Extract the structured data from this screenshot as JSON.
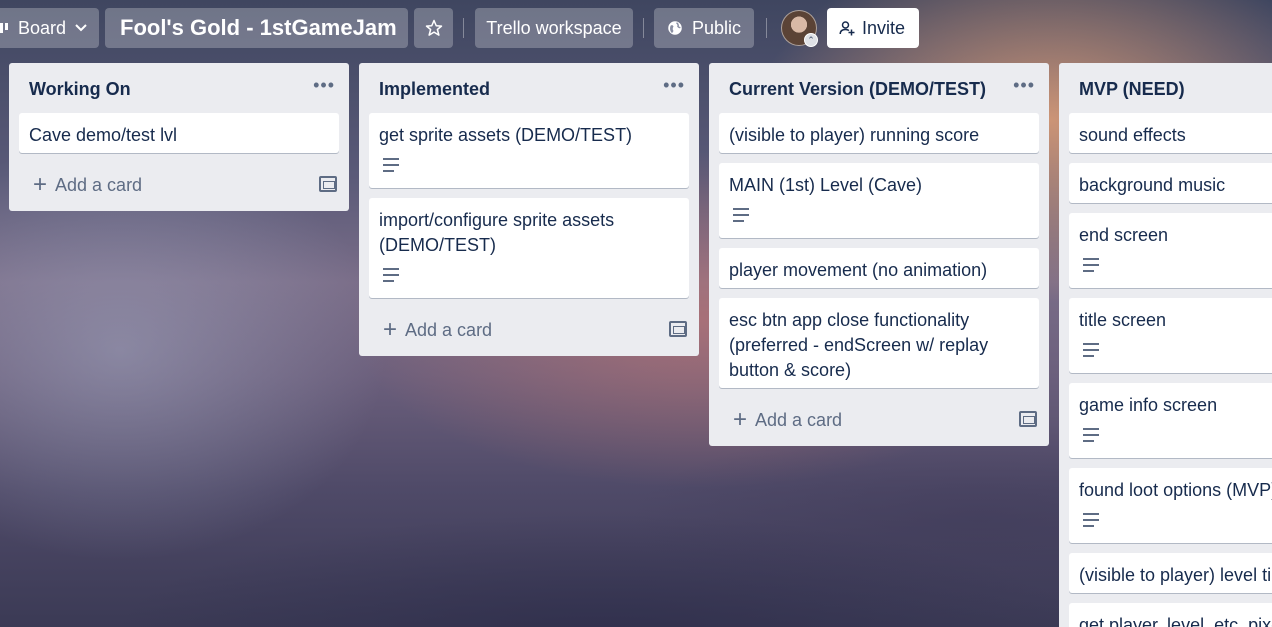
{
  "header": {
    "view_label": "Board",
    "board_title": "Fool's Gold - 1stGameJam",
    "workspace_label": "Trello workspace",
    "visibility_label": "Public",
    "invite_label": "Invite"
  },
  "lists": [
    {
      "title": "Working On",
      "cards": [
        {
          "title": "Cave demo/test lvl"
        }
      ],
      "add_label": "Add a card"
    },
    {
      "title": "Implemented",
      "cards": [
        {
          "title": "get sprite assets (DEMO/TEST)"
        },
        {
          "title": "import/configure sprite assets (DEMO/TEST)"
        }
      ],
      "add_label": "Add a card"
    },
    {
      "title": "Current Version (DEMO/TEST)",
      "cards": [
        {
          "title": "(visible to player) running score"
        },
        {
          "title": "MAIN (1st) Level (Cave)"
        },
        {
          "title": "player movement (no animation)"
        },
        {
          "title": "esc btn app close functionality (preferred - endScreen w/ replay button & score)"
        }
      ],
      "add_label": "Add a card"
    },
    {
      "title": "MVP (NEED)",
      "cards": [
        {
          "title": "sound effects"
        },
        {
          "title": "background music"
        },
        {
          "title": "end screen"
        },
        {
          "title": "title screen"
        },
        {
          "title": "game info screen"
        },
        {
          "title": "found loot options (MVP)"
        },
        {
          "title": "(visible to player) level timer"
        },
        {
          "title": "get player, level, etc. pixel art"
        }
      ]
    }
  ]
}
